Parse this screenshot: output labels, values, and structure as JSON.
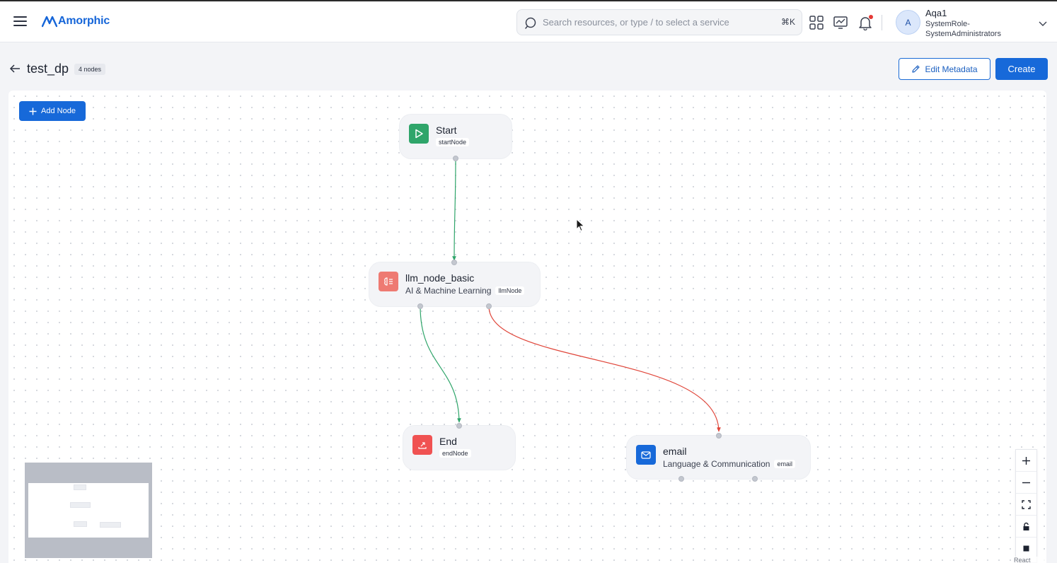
{
  "app": {
    "logo_text": "Amorphic",
    "brand_color": "#1769d9"
  },
  "header": {
    "search_placeholder": "Search resources, or type / to select a service",
    "search_shortcut": "⌘K",
    "icons": [
      "apps-grid-icon",
      "monitor-chart-icon",
      "bell-icon"
    ],
    "user": {
      "initial": "A",
      "name": "Aqa1",
      "role": "SystemRole-SystemAdministrators"
    }
  },
  "page": {
    "title": "test_dp",
    "node_count": "4 nodes",
    "edit_metadata_label": "Edit Metadata",
    "create_label": "Create"
  },
  "canvas": {
    "add_node_label": "Add Node",
    "nodes": [
      {
        "id": "start",
        "title": "Start",
        "subtitle": "",
        "tag": "startNode",
        "icon": "play-icon",
        "icon_color": "#2fa56a"
      },
      {
        "id": "llm",
        "title": "llm_node_basic",
        "subtitle": "AI & Machine Learning",
        "tag": "llmNode",
        "icon": "brain-chip-icon",
        "icon_color": "#ee7a72"
      },
      {
        "id": "end",
        "title": "End",
        "subtitle": "",
        "tag": "endNode",
        "icon": "exit-icon",
        "icon_color": "#f05252"
      },
      {
        "id": "email",
        "title": "email",
        "subtitle": "Language & Communication",
        "tag": "email",
        "icon": "mail-icon",
        "icon_color": "#1769d9"
      }
    ],
    "edges": [
      {
        "from": "start",
        "to": "llm",
        "color": "#2fa56a"
      },
      {
        "from": "llm",
        "to": "end",
        "color": "#2fa56a"
      },
      {
        "from": "llm",
        "to": "email",
        "color": "#e0463a"
      }
    ],
    "attribution": "React Flow"
  }
}
